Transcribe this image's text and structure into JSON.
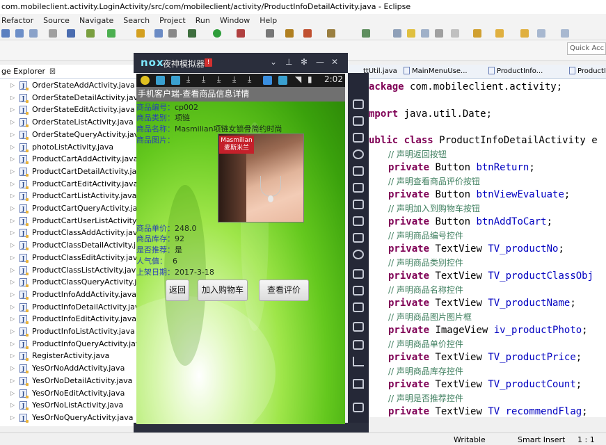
{
  "window": {
    "title": "com.mobileclient.activity.LoginActivity/src/com/mobileclient/activity/ProductInfoDetailActivity.java - Eclipse"
  },
  "menu": [
    "Refactor",
    "Source",
    "Navigate",
    "Search",
    "Project",
    "Run",
    "Window",
    "Help"
  ],
  "quick_access": "Quick Acc",
  "package_explorer": {
    "tab_label": "ge Explorer",
    "close_glyph": "☒",
    "items": [
      "OrderStateAddActivity.java",
      "OrderStateDetailActivity.java",
      "OrderStateEditActivity.java",
      "OrderStateListActivity.java",
      "OrderStateQueryActivity.java",
      "photoListActivity.java",
      "ProductCartAddActivity.java",
      "ProductCartDetailActivity.java",
      "ProductCartEditActivity.java",
      "ProductCartListActivity.java",
      "ProductCartQueryActivity.java",
      "ProductCartUserListActivity.java",
      "ProductClassAddActivity.java",
      "ProductClassDetailActivity.java",
      "ProductClassEditActivity.java",
      "ProductClassListActivity.java",
      "ProductClassQueryActivity.java",
      "ProductInfoAddActivity.java",
      "ProductInfoDetailActivity.java",
      "ProductInfoEditActivity.java",
      "ProductInfoListActivity.java",
      "ProductInfoQueryActivity.java",
      "RegisterActivity.java",
      "YesOrNoAddActivity.java",
      "YesOrNoDetailActivity.java",
      "YesOrNoEditActivity.java",
      "YesOrNoListActivity.java",
      "YesOrNoQueryActivity.java"
    ]
  },
  "editor_tabs": [
    "ttUtil.java",
    "MainMenuUse...",
    "ProductInfo...",
    "ProductI"
  ],
  "code": {
    "l1_kw": "ackage",
    "l1_rest": " com.mobileclient.activity;",
    "l2_kw": "mport",
    "l2_rest": " java.util.Date;",
    "l3_kw": "ublic class",
    "l3_rest": " ProductInfoDetailActivity e",
    "c1": "// 声明返回按钮",
    "kw_private": "private",
    "d1_type": " Button ",
    "d1_name": "btnReturn",
    "semi": ";",
    "c2": "// 声明查看商品评价按钮",
    "d2_type": " Button ",
    "d2_name": "btnViewEvaluate",
    "c3": "// 声明加入到购物车按钮",
    "d3_type": " Button ",
    "d3_name": "btnAddToCart",
    "c4": "// 声明商品编号控件",
    "d4_type": " TextView ",
    "d4_name": "TV_productNo",
    "c5": "// 声明商品类别控件",
    "d5_type": " TextView ",
    "d5_name": "TV_productClassObj",
    "c6": "// 声明商品名称控件",
    "d6_type": " TextView ",
    "d6_name": "TV_productName",
    "c7": "// 声明商品图片图片框",
    "d7_type": " ImageView ",
    "d7_name": "iv_productPhoto",
    "c8": "// 声明商品单价控件",
    "d8_type": " TextView ",
    "d8_name": "TV_productPrice",
    "c9": "// 声明商品库存控件",
    "d9_type": " TextView ",
    "d9_name": "TV_productCount",
    "c10": "// 声明是否推荐控件",
    "d10_type": " TextView ",
    "d10_name": "TV recommendFlag"
  },
  "emulator": {
    "logo": "nox",
    "name": "夜神模拟器",
    "badge": "!",
    "time": "2:02"
  },
  "app": {
    "title": "手机客户端-查看商品信息详情",
    "fields": {
      "no_label": "商品编号：",
      "no_value": "cp002",
      "class_label": "商品类别：",
      "class_value": "项链",
      "name_label": "商品名称：",
      "name_value": "Masmilian项链女锁骨简约时尚",
      "photo_label": "商品图片：",
      "price_label": "商品单价：",
      "price_value": "248.0",
      "count_label": "商品库存：",
      "count_value": "92",
      "recommend_label": "是否推荐：",
      "recommend_value": "是",
      "popularity_label": "人气值：",
      "popularity_value": "6",
      "date_label": "上架日期：",
      "date_value": "2017-3-18"
    },
    "photo_brand_line1": "Masmilian",
    "photo_brand_line2": "麦斯米兰",
    "buttons": {
      "return": "返回",
      "add_to_cart": "加入购物车",
      "view_evaluate": "查看评价"
    }
  },
  "status": {
    "writable": "Writable",
    "insert_mode": "Smart Insert",
    "position": "1 : 1"
  },
  "colors": {
    "keyword": "#7f0055",
    "comment": "#3f7f5f",
    "field": "#0000c0",
    "label_blue": "#2a3fb7"
  }
}
